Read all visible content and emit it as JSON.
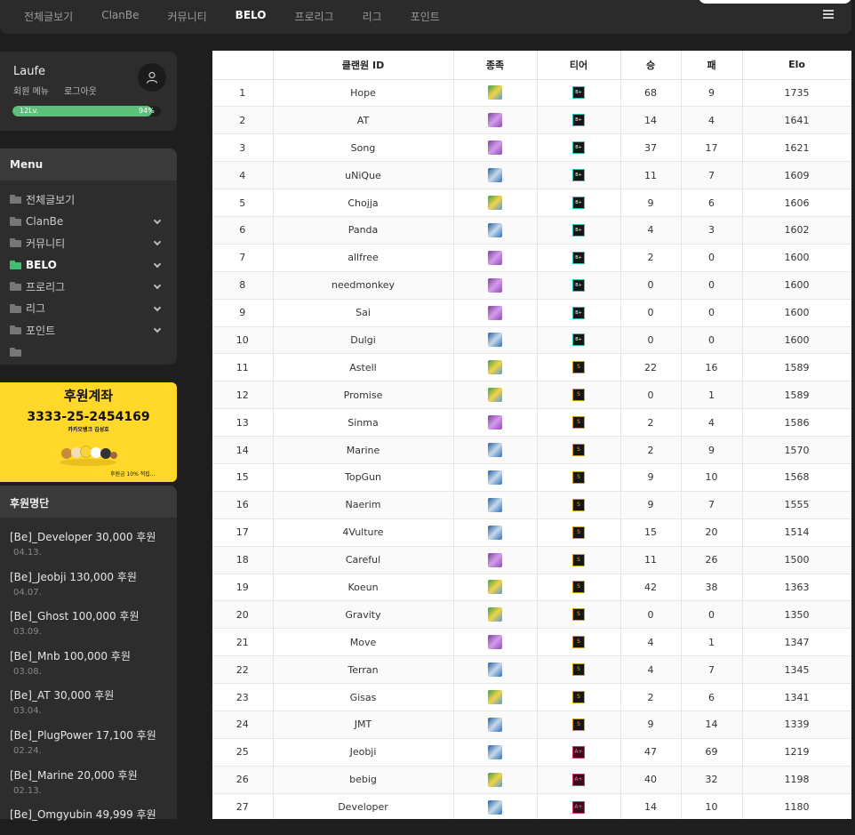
{
  "nav": {
    "items": [
      "전체글보기",
      "ClanBe",
      "커뮤니티",
      "BELO",
      "프로리그",
      "리그",
      "포인트"
    ],
    "active": "BELO"
  },
  "user": {
    "name": "Laufe",
    "member_menu": "회원 메뉴",
    "logout": "로그아웃",
    "level": "12Lv.",
    "progress_label": "94%",
    "progress": 0.94
  },
  "menu": {
    "title": "Menu",
    "items": [
      {
        "label": "전체글보기",
        "expandable": false,
        "active": false
      },
      {
        "label": "ClanBe",
        "expandable": true,
        "active": false
      },
      {
        "label": "커뮤니티",
        "expandable": true,
        "active": false
      },
      {
        "label": "BELO",
        "expandable": true,
        "active": true
      },
      {
        "label": "프로리그",
        "expandable": true,
        "active": false
      },
      {
        "label": "리그",
        "expandable": true,
        "active": false
      },
      {
        "label": "포인트",
        "expandable": true,
        "active": false
      },
      {
        "label": "",
        "expandable": false,
        "active": false
      }
    ]
  },
  "banner": {
    "title": "후원계좌",
    "account": "3333-25-2454169",
    "bank": "카카오뱅크 김성호",
    "note": "후원금 10% 적립..."
  },
  "donors": {
    "title": "후원명단",
    "entries": [
      {
        "msg": "[Be]_Developer 30,000 후원",
        "date": "04.13."
      },
      {
        "msg": "[Be]_Jeobji 130,000 후원",
        "date": "04.07."
      },
      {
        "msg": "[Be]_Ghost 100,000 후원",
        "date": "03.09."
      },
      {
        "msg": "[Be]_Mnb 100,000 후원",
        "date": "03.08."
      },
      {
        "msg": "[Be]_AT 30,000 후원",
        "date": "03.04."
      },
      {
        "msg": "[Be]_PlugPower 17,100 후원",
        "date": "02.24."
      },
      {
        "msg": "[Be]_Marine 20,000 후원",
        "date": "02.13."
      },
      {
        "msg": "[Be]_Omgyubin 49,999 후원",
        "date": ""
      }
    ]
  },
  "table": {
    "headers": [
      "",
      "클랜원 ID",
      "종족",
      "티어",
      "승",
      "패",
      "Elo"
    ],
    "rows": [
      {
        "rank": "1",
        "id": "Hope",
        "race": "P",
        "tier": "B+",
        "win": "68",
        "loss": "9",
        "elo": "1735"
      },
      {
        "rank": "2",
        "id": "AT",
        "race": "Z",
        "tier": "B+",
        "win": "14",
        "loss": "4",
        "elo": "1641"
      },
      {
        "rank": "3",
        "id": "Song",
        "race": "Z",
        "tier": "B+",
        "win": "37",
        "loss": "17",
        "elo": "1621"
      },
      {
        "rank": "4",
        "id": "uNiQue",
        "race": "T",
        "tier": "B+",
        "win": "11",
        "loss": "7",
        "elo": "1609"
      },
      {
        "rank": "5",
        "id": "Chojja",
        "race": "P",
        "tier": "B+",
        "win": "9",
        "loss": "6",
        "elo": "1606"
      },
      {
        "rank": "6",
        "id": "Panda",
        "race": "T",
        "tier": "B+",
        "win": "4",
        "loss": "3",
        "elo": "1602"
      },
      {
        "rank": "7",
        "id": "allfree",
        "race": "Z",
        "tier": "B+",
        "win": "2",
        "loss": "0",
        "elo": "1600"
      },
      {
        "rank": "8",
        "id": "needmonkey",
        "race": "Z",
        "tier": "B+",
        "win": "0",
        "loss": "0",
        "elo": "1600"
      },
      {
        "rank": "9",
        "id": "Sai",
        "race": "Z",
        "tier": "B+",
        "win": "0",
        "loss": "0",
        "elo": "1600"
      },
      {
        "rank": "10",
        "id": "Dulgi",
        "race": "T",
        "tier": "B+",
        "win": "0",
        "loss": "0",
        "elo": "1600"
      },
      {
        "rank": "11",
        "id": "Astell",
        "race": "P",
        "tier": "S",
        "win": "22",
        "loss": "16",
        "elo": "1589"
      },
      {
        "rank": "12",
        "id": "Promise",
        "race": "P",
        "tier": "S",
        "win": "0",
        "loss": "1",
        "elo": "1589"
      },
      {
        "rank": "13",
        "id": "Sinma",
        "race": "Z",
        "tier": "S",
        "win": "2",
        "loss": "4",
        "elo": "1586"
      },
      {
        "rank": "14",
        "id": "Marine",
        "race": "T",
        "tier": "S",
        "win": "2",
        "loss": "9",
        "elo": "1570"
      },
      {
        "rank": "15",
        "id": "TopGun",
        "race": "T",
        "tier": "S",
        "win": "9",
        "loss": "10",
        "elo": "1568"
      },
      {
        "rank": "16",
        "id": "Naerim",
        "race": "T",
        "tier": "S",
        "win": "9",
        "loss": "7",
        "elo": "1555"
      },
      {
        "rank": "17",
        "id": "4Vulture",
        "race": "T",
        "tier": "S",
        "win": "15",
        "loss": "20",
        "elo": "1514"
      },
      {
        "rank": "18",
        "id": "Careful",
        "race": "Z",
        "tier": "S",
        "win": "11",
        "loss": "26",
        "elo": "1500"
      },
      {
        "rank": "19",
        "id": "Koeun",
        "race": "P",
        "tier": "S",
        "win": "42",
        "loss": "38",
        "elo": "1363"
      },
      {
        "rank": "20",
        "id": "Gravity",
        "race": "P",
        "tier": "S",
        "win": "0",
        "loss": "0",
        "elo": "1350"
      },
      {
        "rank": "21",
        "id": "Move",
        "race": "Z",
        "tier": "S",
        "win": "4",
        "loss": "1",
        "elo": "1347"
      },
      {
        "rank": "22",
        "id": "Terran",
        "race": "T",
        "tier": "S",
        "win": "4",
        "loss": "7",
        "elo": "1345"
      },
      {
        "rank": "23",
        "id": "Gisas",
        "race": "P",
        "tier": "S",
        "win": "2",
        "loss": "6",
        "elo": "1341"
      },
      {
        "rank": "24",
        "id": "JMT",
        "race": "T",
        "tier": "S",
        "win": "9",
        "loss": "14",
        "elo": "1339"
      },
      {
        "rank": "25",
        "id": "Jeobji",
        "race": "T",
        "tier": "A+",
        "win": "47",
        "loss": "69",
        "elo": "1219"
      },
      {
        "rank": "26",
        "id": "bebig",
        "race": "P",
        "tier": "A+",
        "win": "40",
        "loss": "32",
        "elo": "1198"
      },
      {
        "rank": "27",
        "id": "Developer",
        "race": "T",
        "tier": "A+",
        "win": "14",
        "loss": "10",
        "elo": "1180"
      }
    ]
  }
}
